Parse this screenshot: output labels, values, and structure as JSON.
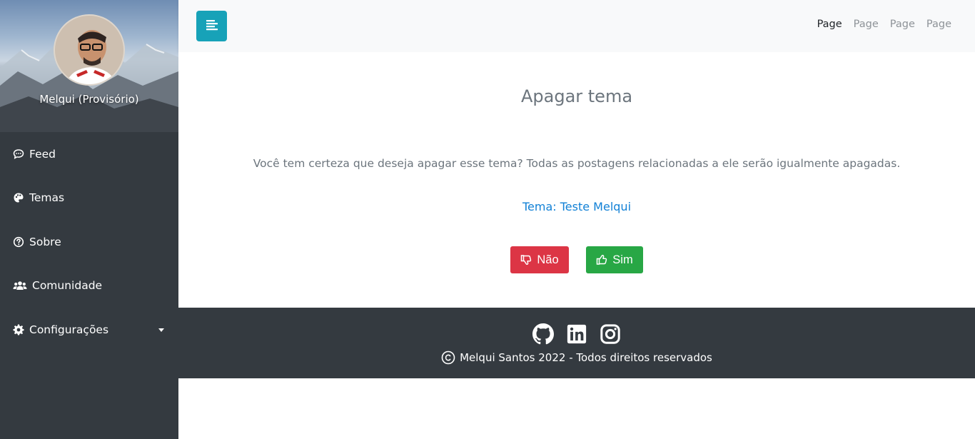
{
  "sidebar": {
    "user_name": "Melqui (Provisório)",
    "items": [
      {
        "label": "Feed",
        "icon": "comment-icon"
      },
      {
        "label": "Temas",
        "icon": "palette-icon"
      },
      {
        "label": "Sobre",
        "icon": "question-circle-icon"
      },
      {
        "label": "Comunidade",
        "icon": "users-icon"
      },
      {
        "label": "Configurações",
        "icon": "gear-icon"
      }
    ]
  },
  "topbar": {
    "nav": [
      "Page",
      "Page",
      "Page",
      "Page"
    ]
  },
  "main": {
    "title": "Apagar tema",
    "confirm_text": "Você tem certeza que deseja apagar esse tema? Todas as postagens relacionadas a ele serão igualmente apagadas.",
    "tema_line": "Tema: Teste Melqui",
    "no_label": "Não",
    "yes_label": "Sim"
  },
  "footer": {
    "copyright": "Melqui Santos 2022 - Todos direitos reservados"
  },
  "colors": {
    "sidebar_bg": "#343a40",
    "topbar_bg": "#f8f9fa",
    "toggle": "#17a2b8",
    "danger": "#dc3545",
    "success": "#28a745",
    "link": "#1281d6"
  }
}
